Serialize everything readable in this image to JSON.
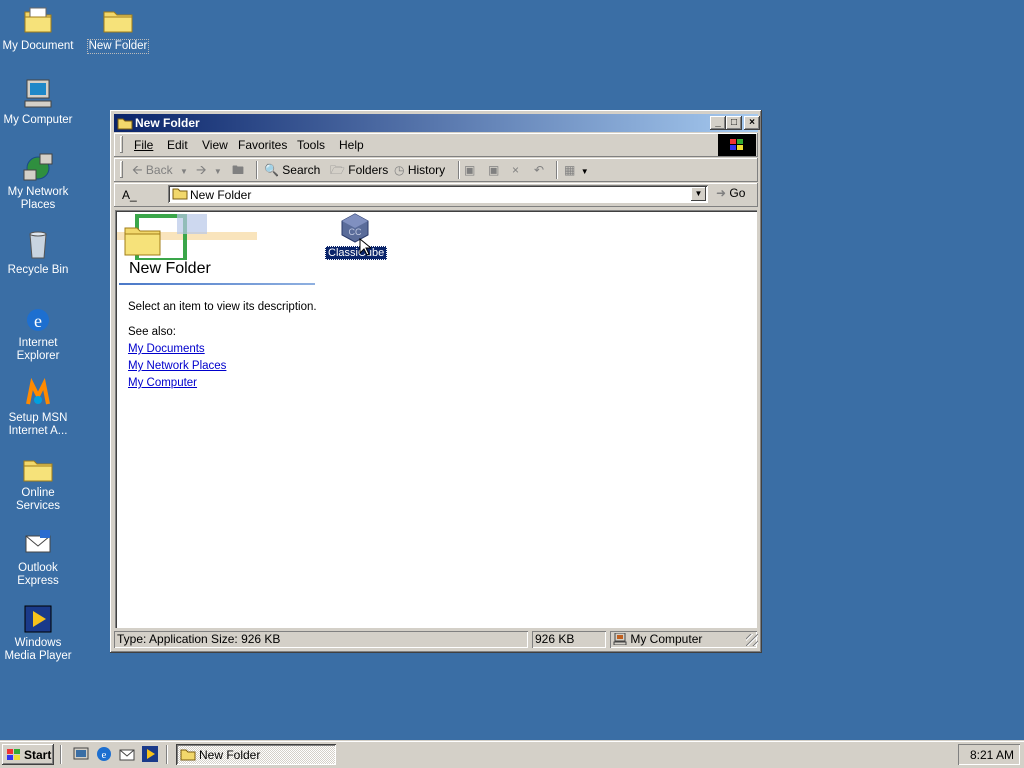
{
  "desktop": {
    "icons": [
      {
        "label": "My Document",
        "icon": "my-documents-icon"
      },
      {
        "label": "New Folder",
        "icon": "folder-icon"
      },
      {
        "label": "My Computer",
        "icon": "my-computer-icon"
      },
      {
        "label": "My Network Places",
        "icon": "network-places-icon"
      },
      {
        "label": "Recycle Bin",
        "icon": "recycle-bin-icon"
      },
      {
        "label": "Internet Explorer",
        "icon": "internet-explorer-icon"
      },
      {
        "label": "Setup MSN Internet A...",
        "icon": "msn-icon"
      },
      {
        "label": "Online Services",
        "icon": "folder-icon"
      },
      {
        "label": "Outlook Express",
        "icon": "outlook-express-icon"
      },
      {
        "label": "Windows Media Player",
        "icon": "media-player-icon"
      }
    ]
  },
  "window": {
    "title": "New Folder",
    "controls": {
      "minimize": "_",
      "maximize": "□",
      "close": "×"
    },
    "menu": [
      {
        "label": "File"
      },
      {
        "label": "Edit"
      },
      {
        "label": "View"
      },
      {
        "label": "Favorites"
      },
      {
        "label": "Tools"
      },
      {
        "label": "Help"
      }
    ],
    "toolbar": {
      "back": "Back",
      "search": "Search",
      "folders": "Folders",
      "history": "History"
    },
    "address": {
      "label": "A_",
      "value": "New Folder",
      "go": "Go"
    },
    "content": {
      "heading": "New Folder",
      "description": "Select an item to view its description.",
      "see_also": "See also:",
      "links": [
        "My Documents",
        "My Network Places",
        "My Computer"
      ],
      "file": {
        "label": "ClassiCube",
        "icon": "classicube-app-icon"
      }
    },
    "status": {
      "info": "Type: Application Size: 926 KB",
      "size": "926 KB",
      "zone": "My Computer"
    }
  },
  "taskbar": {
    "start": "Start",
    "task": "New Folder",
    "clock": "8:21 AM"
  },
  "colors": {
    "desktop": "#3a6ea5",
    "title_active": "#0a246a",
    "face": "#d4d0c8",
    "link": "#0000cc"
  }
}
